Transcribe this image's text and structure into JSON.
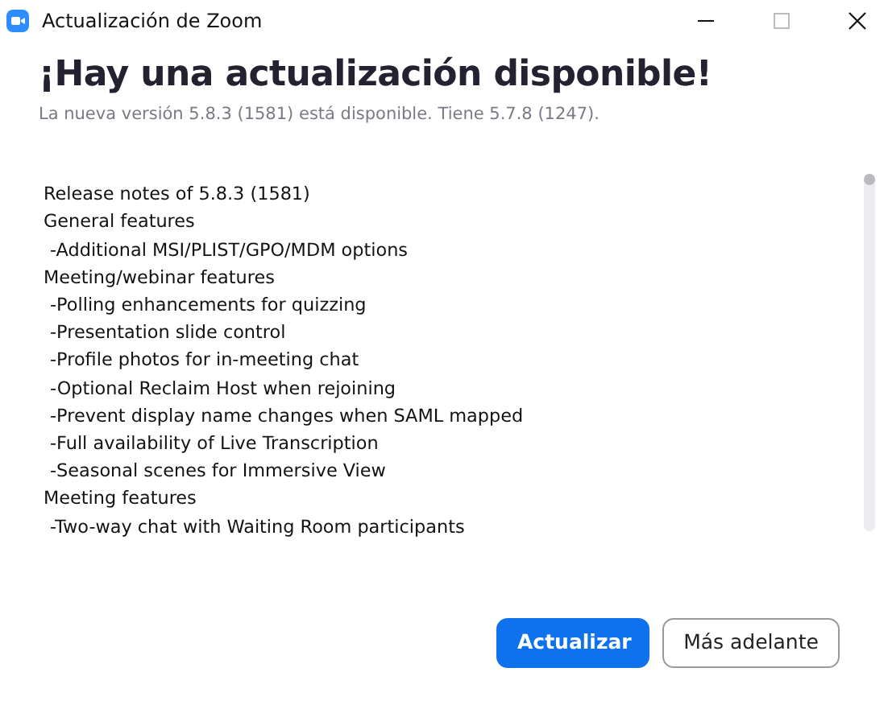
{
  "window": {
    "title": "Actualización de Zoom"
  },
  "heading": "¡Hay una actualización disponible!",
  "subtitle": "La nueva versión 5.8.3 (1581) está disponible. Tiene 5.7.8 (1247).",
  "notes": [
    {
      "kind": "heading",
      "text": "Release notes of 5.8.3 (1581)"
    },
    {
      "kind": "heading",
      "text": "General features"
    },
    {
      "kind": "item",
      "text": "-Additional MSI/PLIST/GPO/MDM options"
    },
    {
      "kind": "heading",
      "text": "Meeting/webinar features"
    },
    {
      "kind": "item",
      "text": "-Polling enhancements for quizzing"
    },
    {
      "kind": "item",
      "text": "-Presentation slide control"
    },
    {
      "kind": "item",
      "text": "-Profile photos for in-meeting chat"
    },
    {
      "kind": "item",
      "text": "-Optional Reclaim Host when rejoining"
    },
    {
      "kind": "item",
      "text": "-Prevent display name changes when SAML mapped"
    },
    {
      "kind": "item",
      "text": "-Full availability of Live Transcription"
    },
    {
      "kind": "item",
      "text": "-Seasonal scenes for Immersive View"
    },
    {
      "kind": "heading",
      "text": "Meeting features"
    },
    {
      "kind": "item",
      "text": "-Two-way chat with Waiting Room participants"
    }
  ],
  "buttons": [
    {
      "label": "Actualizar",
      "kind": "primary"
    },
    {
      "label": "Más adelante",
      "kind": "secondary"
    }
  ]
}
